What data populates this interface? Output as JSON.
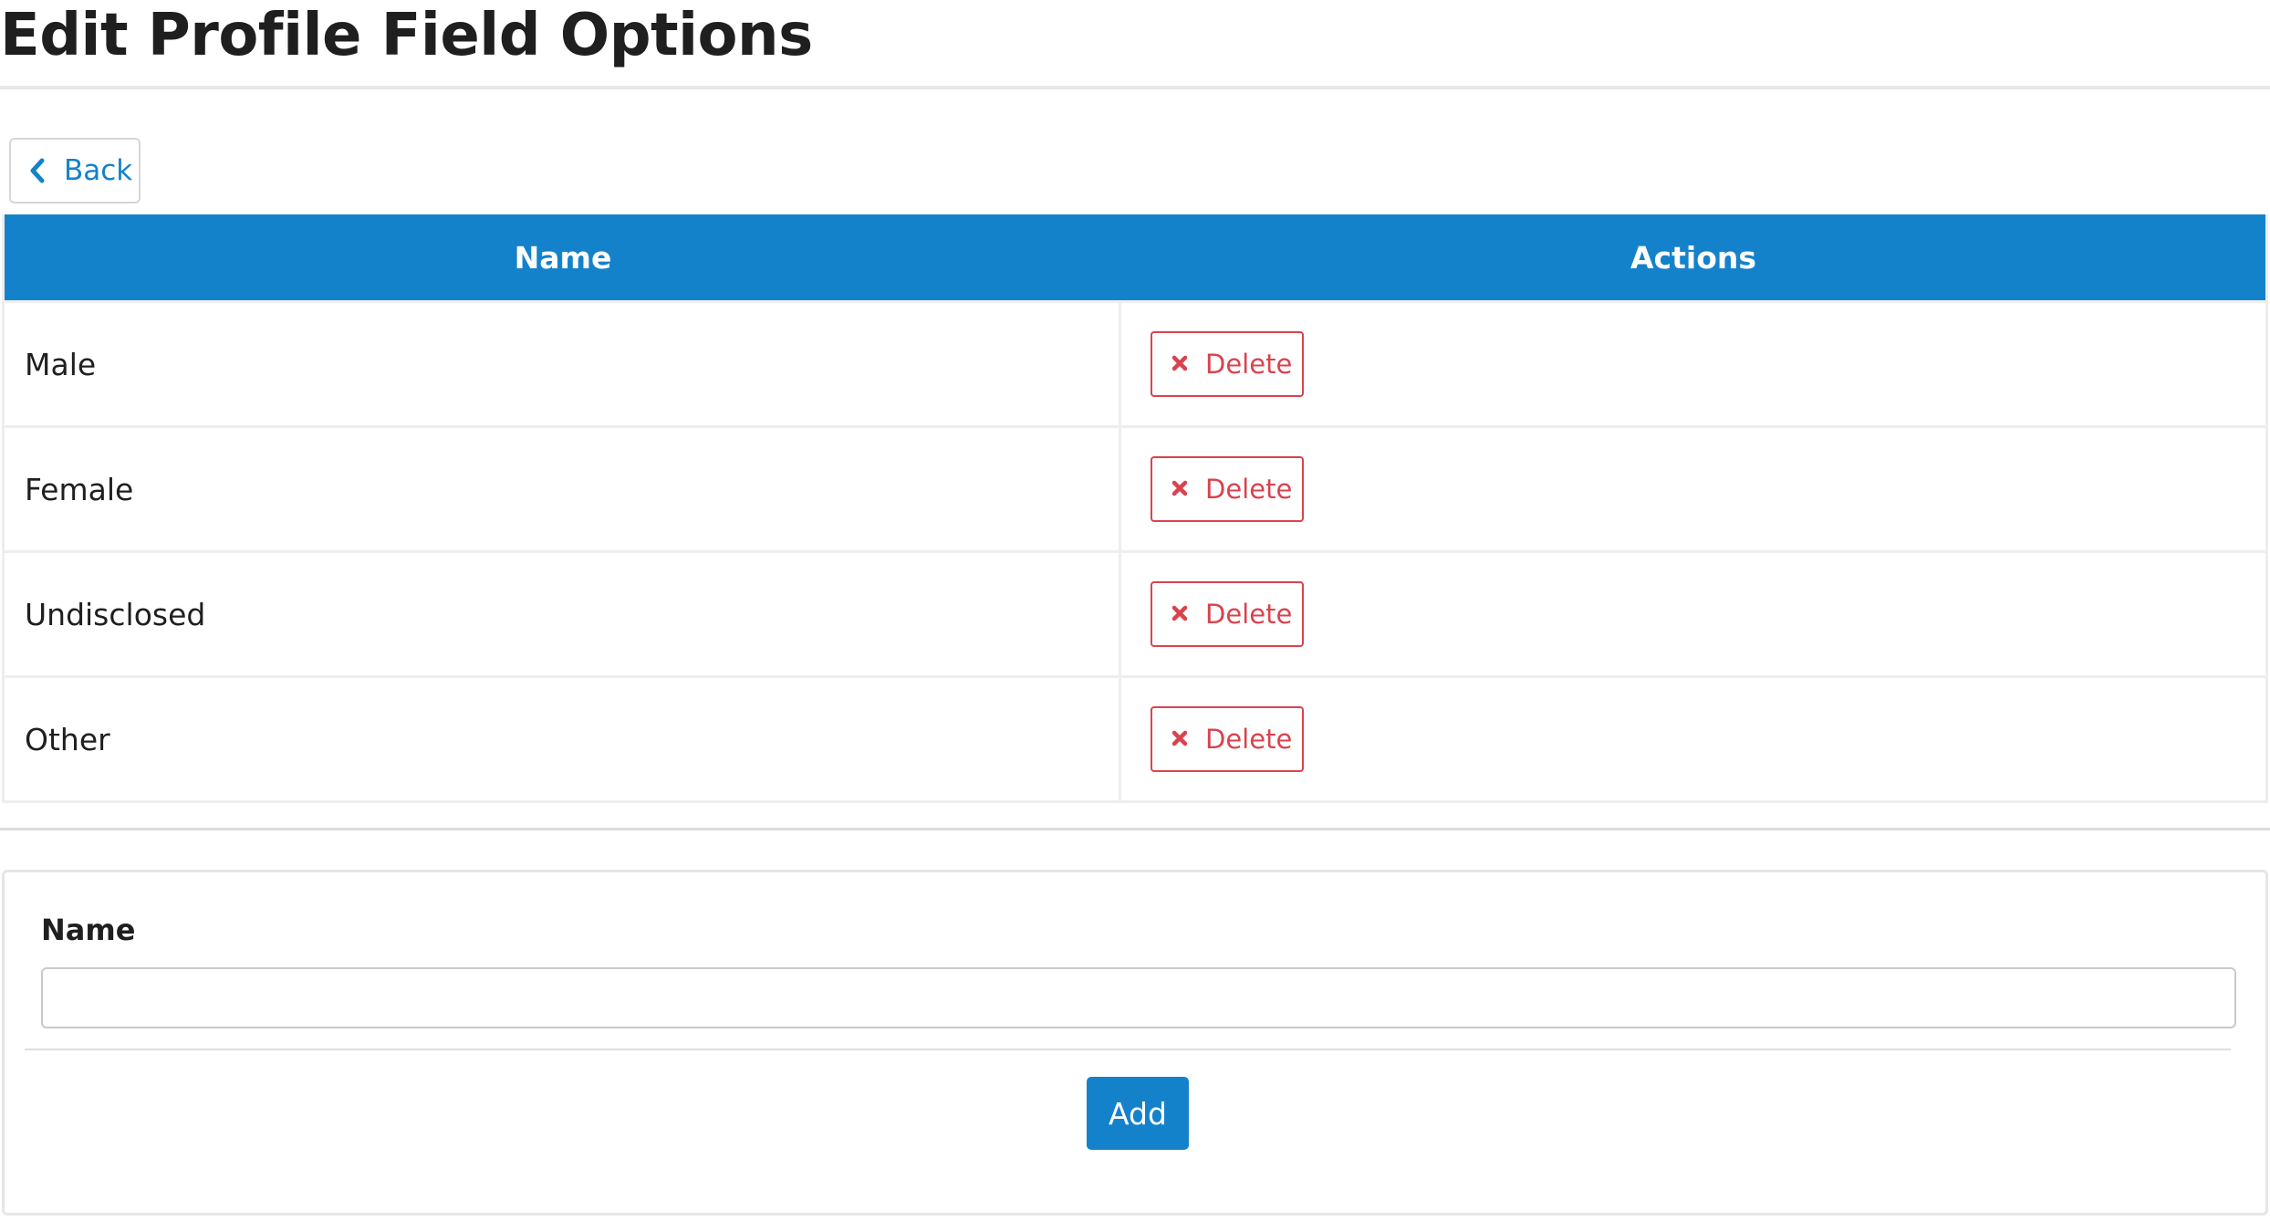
{
  "page": {
    "title": "Edit Profile Field Options"
  },
  "toolbar": {
    "back_label": "Back",
    "back_icon": "chevron-left-icon"
  },
  "table": {
    "headers": {
      "name": "Name",
      "actions": "Actions"
    },
    "rows": [
      {
        "name": "Male",
        "action_label": "Delete"
      },
      {
        "name": "Female",
        "action_label": "Delete"
      },
      {
        "name": "Undisclosed",
        "action_label": "Delete"
      },
      {
        "name": "Other",
        "action_label": "Delete"
      }
    ],
    "delete_icon": "x-icon"
  },
  "form": {
    "name_label": "Name",
    "name_value": "",
    "name_placeholder": "",
    "add_label": "Add"
  },
  "colors": {
    "primary": "#1482cb",
    "danger": "#d9434e",
    "border": "#eeeeee",
    "title_text": "#1f1f1f"
  }
}
